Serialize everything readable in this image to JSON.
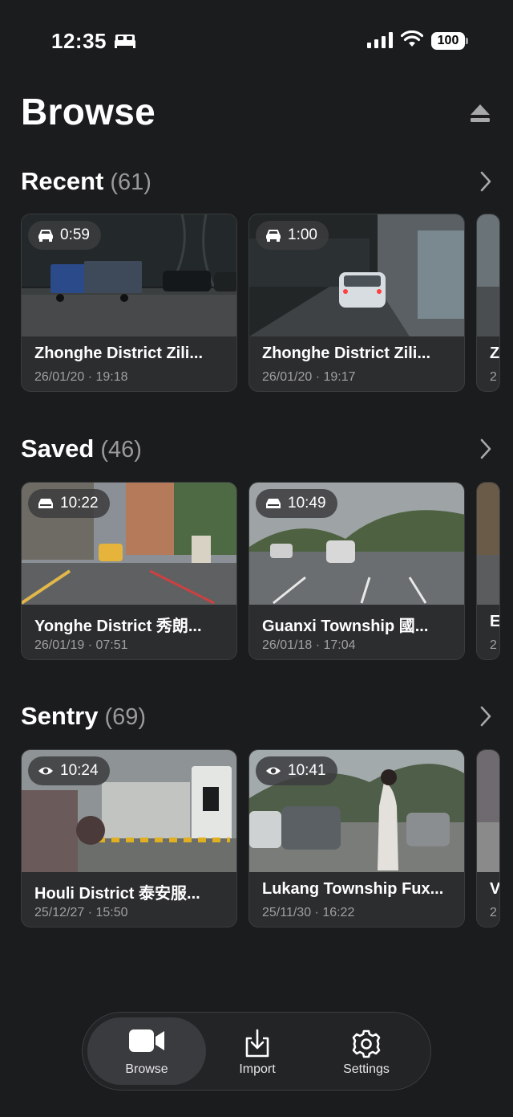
{
  "status_bar": {
    "time": "12:35",
    "battery": "100"
  },
  "header": {
    "title": "Browse"
  },
  "sections": [
    {
      "title": "Recent",
      "count": "(61)",
      "cards": [
        {
          "badge_icon": "car-icon",
          "duration": "0:59",
          "title": "Zhonghe District Zili...",
          "date": "26/01/20 · 19:18"
        },
        {
          "badge_icon": "car-icon",
          "duration": "1:00",
          "title": "Zhonghe District Zili...",
          "date": "26/01/20 · 19:17"
        },
        {
          "title": "Z",
          "date": "2"
        }
      ]
    },
    {
      "title": "Saved",
      "count": "(46)",
      "cards": [
        {
          "badge_icon": "save-icon",
          "duration": "10:22",
          "title": "Yonghe District 秀朗...",
          "date": "26/01/19 · 07:51"
        },
        {
          "badge_icon": "save-icon",
          "duration": "10:49",
          "title": "Guanxi Township 國...",
          "date": "26/01/18 · 17:04"
        },
        {
          "title": "E",
          "date": "2"
        }
      ]
    },
    {
      "title": "Sentry",
      "count": "(69)",
      "cards": [
        {
          "badge_icon": "eye-icon",
          "duration": "10:24",
          "title": "Houli District 泰安服...",
          "date": "25/12/27 · 15:50"
        },
        {
          "badge_icon": "eye-icon",
          "duration": "10:41",
          "title": "Lukang Township Fux...",
          "date": "25/11/30 · 16:22"
        },
        {
          "title": "V",
          "date": "2"
        }
      ]
    }
  ],
  "tab_bar": {
    "tabs": [
      {
        "label": "Browse",
        "icon": "video-camera-icon",
        "active": true
      },
      {
        "label": "Import",
        "icon": "import-icon",
        "active": false
      },
      {
        "label": "Settings",
        "icon": "gear-icon",
        "active": false
      }
    ]
  }
}
